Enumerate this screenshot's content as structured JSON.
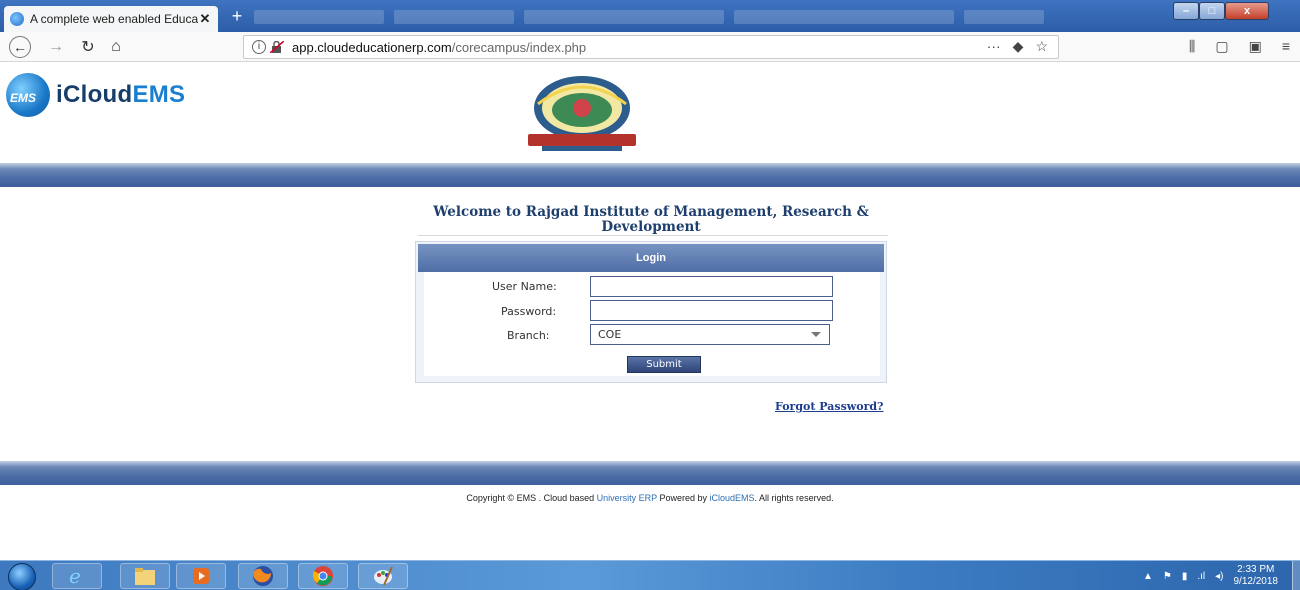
{
  "browser": {
    "active_tab_title": "A complete web enabled Educa",
    "tab_close": "✕",
    "new_tab": "+",
    "url_host": "app.cloudeducationerp.com",
    "url_path": "/corecampus/index.php",
    "page_actions": "···"
  },
  "brand": {
    "logo_mark": "EMS",
    "name_prefix": "iCloud",
    "name_suffix": "EMS"
  },
  "welcome": {
    "line1": "Welcome to Rajgad Institute of Management, Research &",
    "line2": "Development"
  },
  "login": {
    "header": "Login",
    "username_label": "User Name:",
    "username_value": "",
    "password_label": "Password:",
    "password_value": "",
    "branch_label": "Branch:",
    "branch_selected": "COE",
    "submit_label": "Submit"
  },
  "forgot_password": "Forgot Password?",
  "footer": {
    "copyright_prefix": "Copyright © EMS . Cloud based ",
    "erp_link": "University ERP",
    "middle": " Powered by ",
    "brand_link": "iCloudEMS",
    "suffix": ". All rights reserved."
  },
  "taskbar": {
    "apps": [
      "internet-explorer",
      "file-explorer",
      "media-player",
      "firefox",
      "chrome",
      "paint"
    ],
    "clock_time": "2:33 PM",
    "clock_date": "9/12/2018"
  },
  "colors": {
    "band": "#4c6ea8",
    "panel_header": "#5f7eb3",
    "link": "#1d3d8f",
    "heading": "#1e3f6e"
  }
}
